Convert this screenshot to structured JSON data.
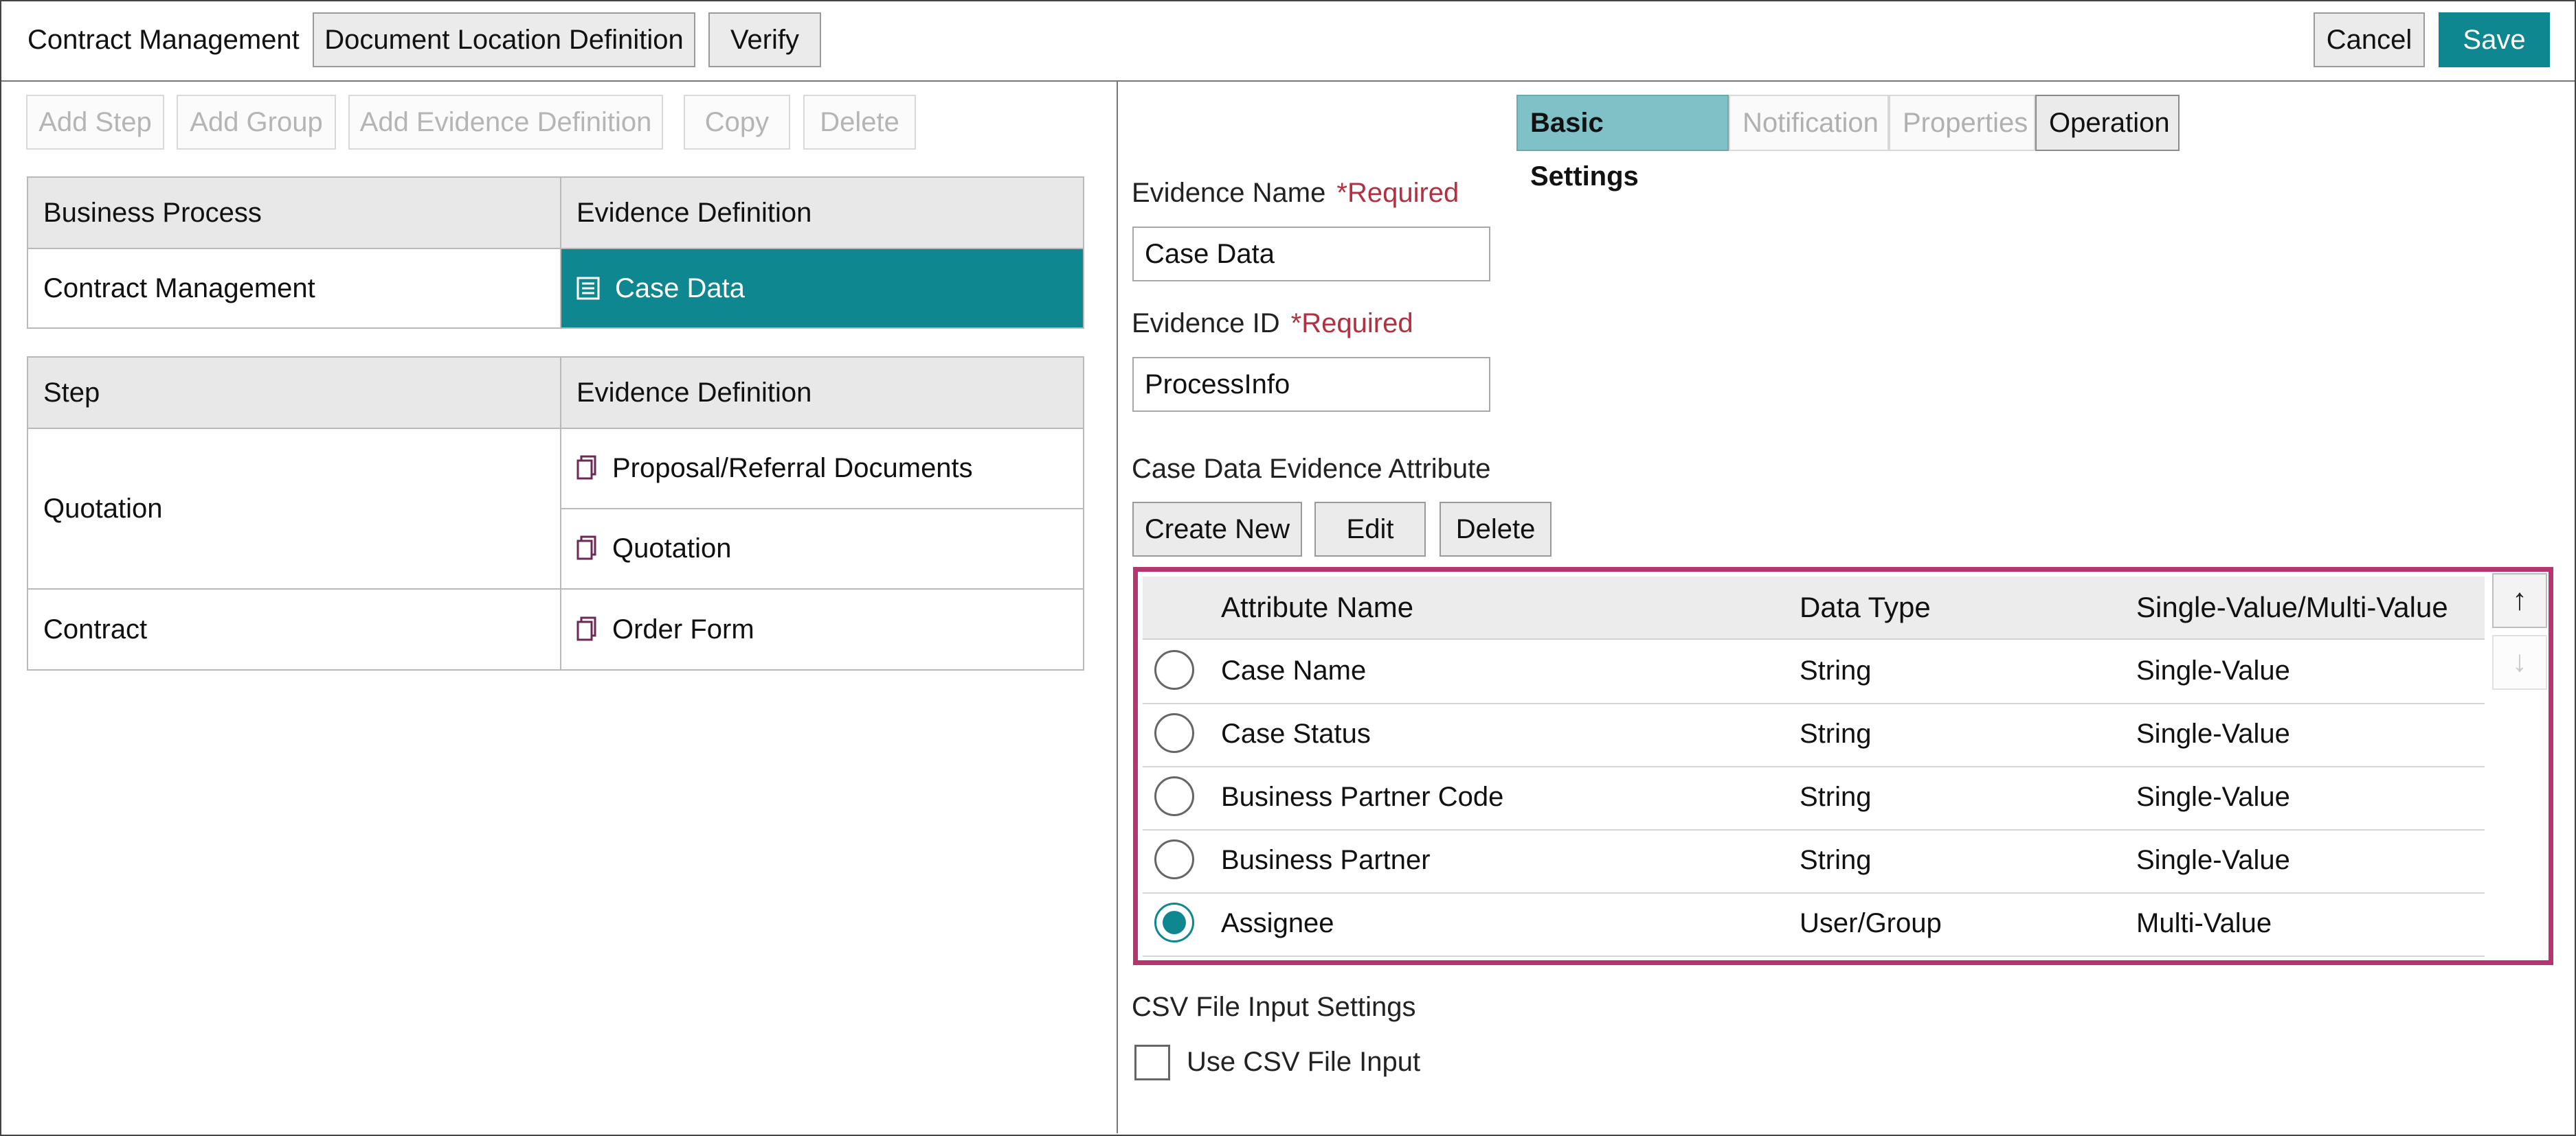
{
  "header": {
    "title": "Contract Management",
    "document_location_button": "Document Location Definition",
    "verify_button": "Verify",
    "cancel_button": "Cancel",
    "save_button": "Save",
    "accent_color": "#0e8790"
  },
  "left_toolbar": {
    "add_step": "Add Step",
    "add_group": "Add Group",
    "add_evidence_definition": "Add Evidence Definition",
    "copy": "Copy",
    "delete": "Delete"
  },
  "process_table": {
    "headers": [
      "Business Process",
      "Evidence Definition"
    ],
    "row": {
      "process": "Contract Management",
      "evidence": "Case Data",
      "evidence_icon": "list-icon",
      "selected": true
    }
  },
  "step_table": {
    "headers": [
      "Step",
      "Evidence Definition"
    ],
    "rows": [
      {
        "step": "Quotation",
        "evidences": [
          {
            "label": "Proposal/Referral Documents",
            "icon": "document-icon"
          },
          {
            "label": "Quotation",
            "icon": "document-icon"
          }
        ]
      },
      {
        "step": "Contract",
        "evidences": [
          {
            "label": "Order Form",
            "icon": "document-icon"
          }
        ]
      }
    ]
  },
  "tabs": [
    {
      "label": "Basic Settings",
      "state": "active"
    },
    {
      "label": "Notification",
      "state": "disabled"
    },
    {
      "label": "Properties",
      "state": "disabled"
    },
    {
      "label": "Operation",
      "state": "enabled"
    }
  ],
  "form": {
    "evidence_name_label": "Evidence Name",
    "evidence_name_required": "*Required",
    "evidence_name_value": "Case Data",
    "evidence_id_label": "Evidence ID",
    "evidence_id_required": "*Required",
    "evidence_id_value": "ProcessInfo",
    "attribute_section_label": "Case Data Evidence Attribute",
    "create_new": "Create New",
    "edit": "Edit",
    "delete": "Delete"
  },
  "attributes": {
    "headers": [
      "Attribute Name",
      "Data Type",
      "Single-Value/Multi-Value"
    ],
    "rows": [
      {
        "name": "Case Name",
        "type": "String",
        "value_mode": "Single-Value",
        "selected": false
      },
      {
        "name": "Case Status",
        "type": "String",
        "value_mode": "Single-Value",
        "selected": false
      },
      {
        "name": "Business Partner Code",
        "type": "String",
        "value_mode": "Single-Value",
        "selected": false
      },
      {
        "name": "Business Partner",
        "type": "String",
        "value_mode": "Single-Value",
        "selected": false
      },
      {
        "name": "Assignee",
        "type": "User/Group",
        "value_mode": "Multi-Value",
        "selected": true
      }
    ],
    "move_up_icon": "arrow-up-icon",
    "move_down_icon": "arrow-down-icon",
    "highlight_color": "#b5366e"
  },
  "csv": {
    "section_label": "CSV File Input Settings",
    "checkbox_label": "Use CSV File Input",
    "checked": false
  }
}
